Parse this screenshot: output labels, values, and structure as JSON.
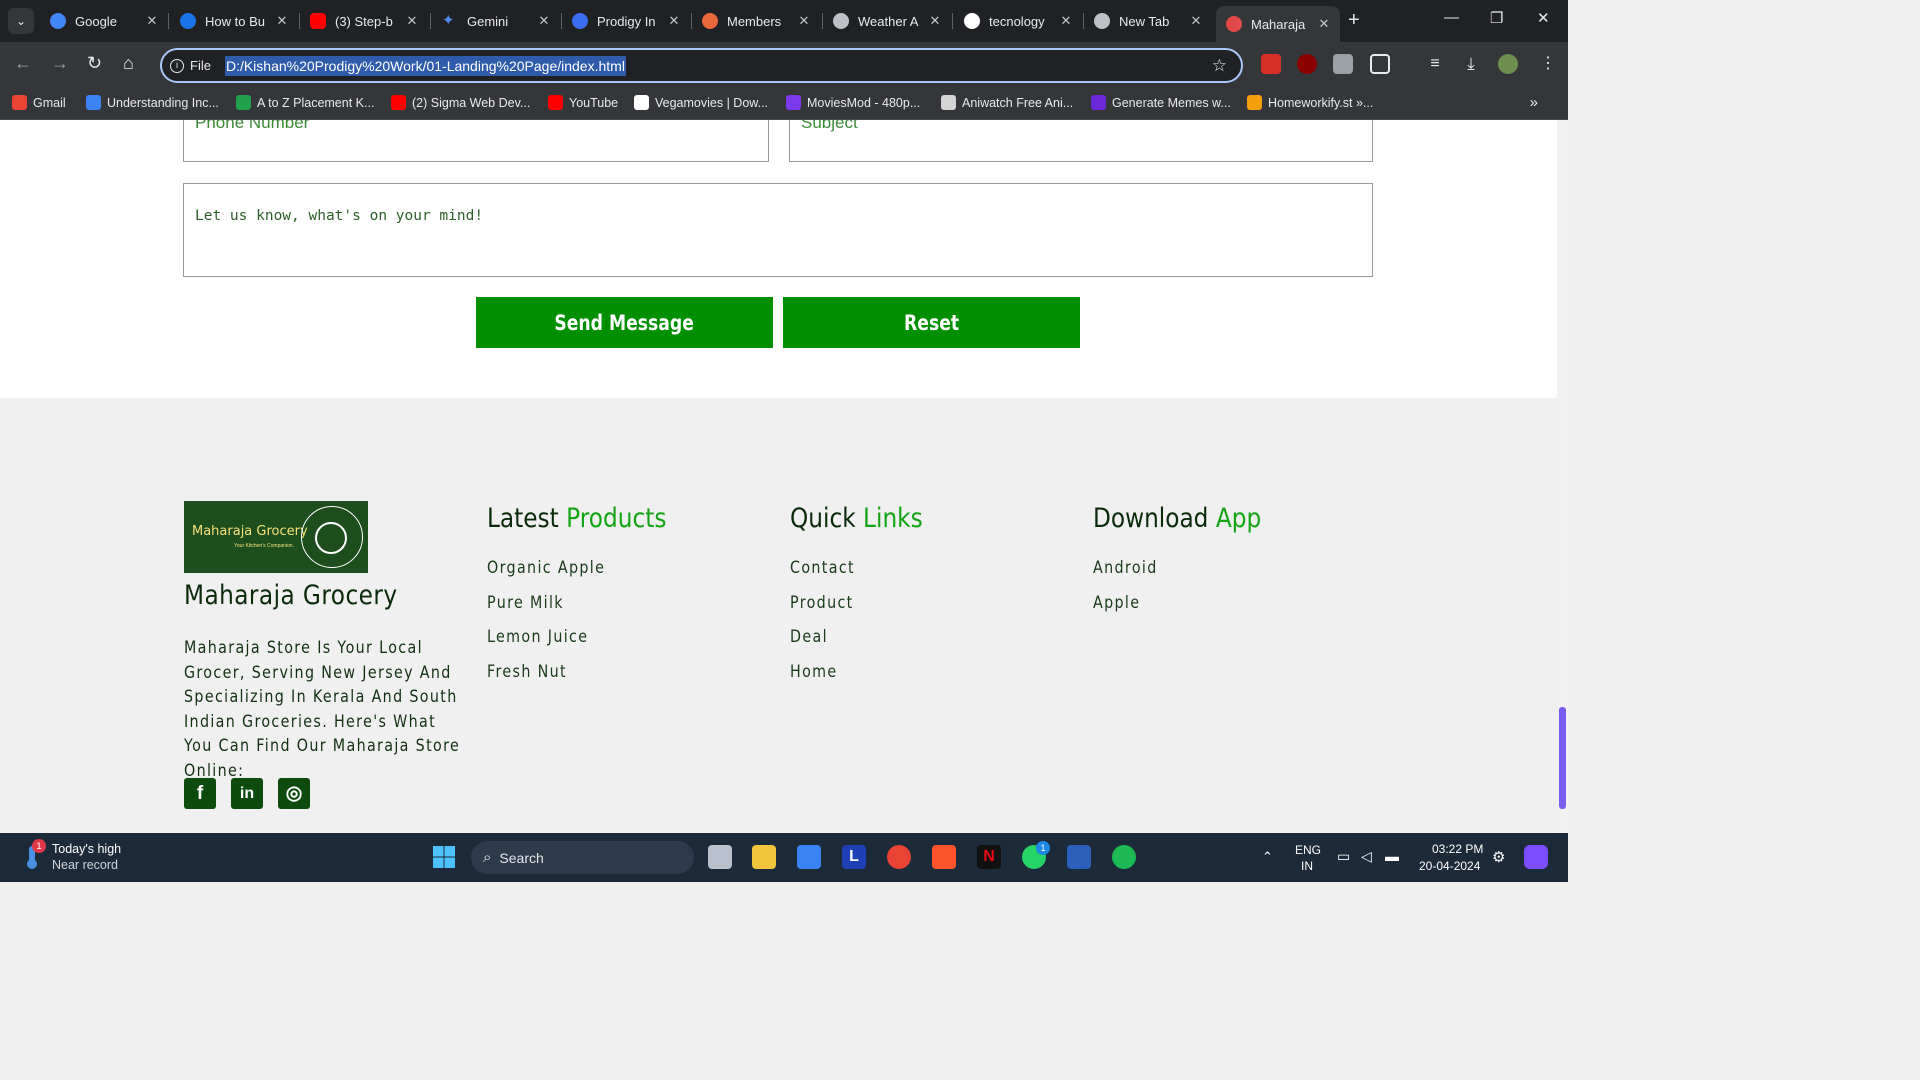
{
  "browser": {
    "tabs": [
      {
        "label": "Google",
        "favicon_color": "#4285f4"
      },
      {
        "label": "How to Bu",
        "favicon_color": "#1a73e8"
      },
      {
        "label": "(3) Step-b",
        "favicon_color": "#ff0000"
      },
      {
        "label": "Gemini",
        "favicon_color": "#4e8df5"
      },
      {
        "label": "Prodigy In",
        "favicon_color": "#3c6df0"
      },
      {
        "label": "Members",
        "favicon_color": "#e8663c"
      },
      {
        "label": "Weather A",
        "favicon_color": "#bdc1c6"
      },
      {
        "label": "tecnology",
        "favicon_color": "#ffffff"
      },
      {
        "label": "New Tab",
        "favicon_color": "#bdc1c6"
      },
      {
        "label": "Maharaja",
        "favicon_color": "#e04a4a"
      }
    ],
    "active_tab_index": 9,
    "new_tab_label": "+",
    "omnibox": {
      "chip_label": "File",
      "url": "D:/Kishan%20Prodigy%20Work/01-Landing%20Page/index.html"
    },
    "bookmarks": [
      {
        "label": "Gmail",
        "color": "#ea4335"
      },
      {
        "label": "Understanding Inc...",
        "color": "#3b82f6"
      },
      {
        "label": "A to Z Placement K...",
        "color": "#22a04b"
      },
      {
        "label": "(2) Sigma Web Dev...",
        "color": "#ff0000"
      },
      {
        "label": "YouTube",
        "color": "#ff0000"
      },
      {
        "label": "Vegamovies | Dow...",
        "color": "#ffffff"
      },
      {
        "label": "MoviesMod - 480p...",
        "color": "#7c3aed"
      },
      {
        "label": "Aniwatch Free Ani...",
        "color": "#d4d4d4"
      },
      {
        "label": "Generate Memes w...",
        "color": "#6d28d9"
      },
      {
        "label": "Homeworkify.st »...",
        "color": "#f59e0b"
      }
    ]
  },
  "contact_form": {
    "phone_placeholder": "Phone Number",
    "subject_placeholder": "Subject",
    "message_placeholder": "Let us know, what's on your mind!",
    "send_label": "Send Message",
    "reset_label": "Reset"
  },
  "footer": {
    "logo": {
      "text": "Maharaja Grocery",
      "tagline": "Your Kitchen's Companion."
    },
    "brand_title": "Maharaja Grocery",
    "brand_description": "Maharaja Store Is Your Local Grocer, Serving New Jersey And Specializing In Kerala And South Indian Groceries. Here's What You Can Find Our Maharaja Store Online:",
    "social": [
      "f",
      "in",
      "◎"
    ],
    "columns": [
      {
        "title_plain": "Latest",
        "title_accent": "Products",
        "links": [
          "Organic Apple",
          "Pure Milk",
          "Lemon Juice",
          "Fresh Nut"
        ]
      },
      {
        "title_plain": "Quick",
        "title_accent": "Links",
        "links": [
          "Contact",
          "Product",
          "Deal",
          "Home"
        ]
      },
      {
        "title_plain": "Download",
        "title_accent": "App",
        "links": [
          "Android",
          "Apple"
        ]
      }
    ]
  },
  "taskbar": {
    "weather_title": "Today's high",
    "weather_sub": "Near record",
    "weather_badge": "1",
    "search_label": "Search",
    "whatsapp_badge": "1",
    "lang_top": "ENG",
    "lang_bottom": "IN",
    "time": "03:22 PM",
    "date": "20-04-2024"
  },
  "colors": {
    "accent_green": "#008f00",
    "title_green": "#13a413",
    "dark_green": "#0b2a0b"
  }
}
